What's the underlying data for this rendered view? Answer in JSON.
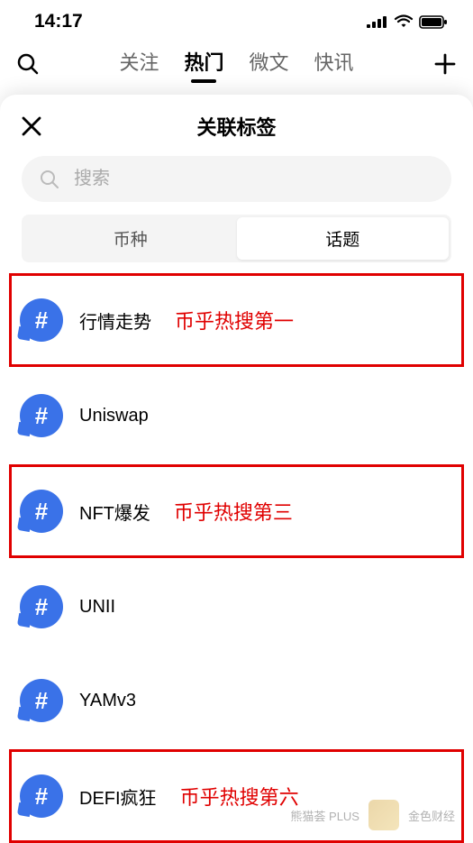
{
  "status": {
    "time": "14:17"
  },
  "topNav": {
    "tabs": [
      "关注",
      "热门",
      "微文",
      "快讯"
    ],
    "activeIndex": 1
  },
  "sheet": {
    "title": "关联标签",
    "searchPlaceholder": "搜索",
    "segments": [
      "币种",
      "话题"
    ],
    "activeSegment": 1,
    "topics": [
      {
        "label": "行情走势",
        "highlight": true,
        "annotation": "币乎热搜第一"
      },
      {
        "label": "Uniswap",
        "highlight": false,
        "annotation": ""
      },
      {
        "label": "NFT爆发",
        "highlight": true,
        "annotation": "币乎热搜第三"
      },
      {
        "label": "UNII",
        "highlight": false,
        "annotation": ""
      },
      {
        "label": "YAMv3",
        "highlight": false,
        "annotation": ""
      },
      {
        "label": "DEFI疯狂",
        "highlight": true,
        "annotation": "币乎热搜第六"
      }
    ]
  },
  "watermark": {
    "text1": "熊猫荟 PLUS",
    "text2": "金色财经"
  }
}
